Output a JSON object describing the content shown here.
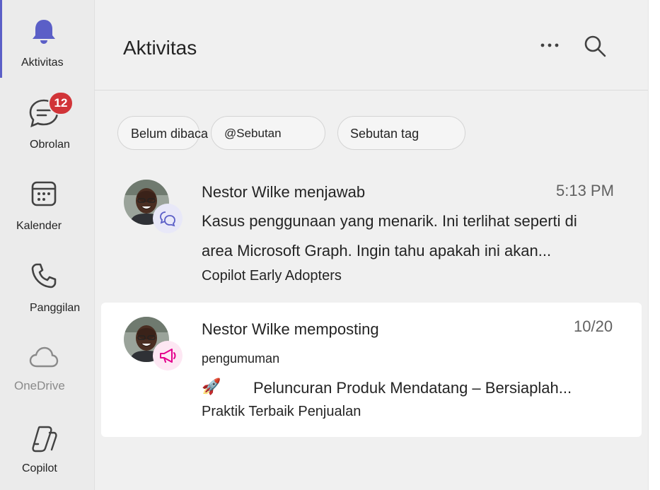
{
  "rail": {
    "items": [
      {
        "label": "Aktivitas",
        "icon": "bell-icon"
      },
      {
        "label": "Obrolan",
        "icon": "chat-icon",
        "badge": "12"
      },
      {
        "label": "Kalender",
        "icon": "calendar-icon"
      },
      {
        "label": "Panggilan",
        "icon": "phone-icon"
      },
      {
        "label": "OneDrive",
        "icon": "cloud-icon"
      },
      {
        "label": "Copilot",
        "icon": "copilot-icon"
      }
    ]
  },
  "header": {
    "title": "Aktivitas",
    "more_icon": "more-icon",
    "search_icon": "search-icon"
  },
  "filters": [
    {
      "label": "Belum dibaca"
    },
    {
      "label": "@Sebutan"
    },
    {
      "label": "Sebutan tag"
    }
  ],
  "feed": [
    {
      "name": "Nestor Wilke menjawab",
      "time": "5:13 PM",
      "line1": "Kasus penggunaan yang menarik. Ini terlihat seperti di",
      "line2": "area Microsoft Graph. Ingin tahu apakah ini akan...",
      "channel": "Copilot Early Adopters",
      "type_icon": "reply-icon"
    },
    {
      "name": "Nestor Wilke memposting",
      "time": "10/20",
      "label": "pengumuman",
      "emoji": "🚀",
      "headline": "Peluncuran Produk Mendatang – Bersiaplah...",
      "channel": "Praktik Terbaik Penjualan",
      "type_icon": "megaphone-icon"
    }
  ],
  "colors": {
    "accent": "#5b5fc7",
    "badge": "#d13438",
    "announcement": "#e3008c"
  }
}
